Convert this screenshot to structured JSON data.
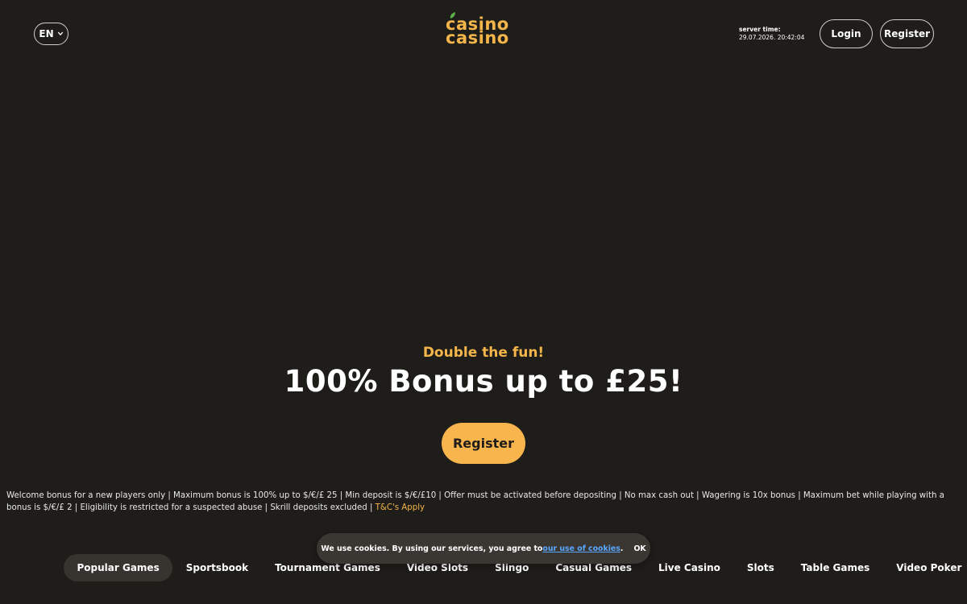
{
  "header": {
    "language": "EN",
    "logo": {
      "line1": "casino",
      "line2": "casino"
    },
    "server_time_label": "server time:",
    "server_time_value": "29.07.2026. 20:42:04",
    "login_label": "Login",
    "register_label": "Register"
  },
  "hero": {
    "kicker": "Double the fun!",
    "title": "100% Bonus up to £25!",
    "cta_label": "Register"
  },
  "terms": {
    "text": "Welcome bonus for a new players only | Maximum bonus is 100% up to $/€/£ 25 | Min deposit is $/€/£10 | Offer must be activated before depositing | No max cash out | Wagering is 10x bonus | Maximum bet while playing with a bonus is $/€/£ 2 | Eligibility is restricted for a suspected abuse | Skrill deposits excluded | ",
    "link_label": "T&C's Apply"
  },
  "cookie": {
    "text": "We use cookies. By using our services, you agree to ",
    "link_label": "our use of cookies",
    "suffix": ".",
    "ok_label": "OK"
  },
  "categories": [
    {
      "label": "Popular Games",
      "active": true
    },
    {
      "label": "Sportsbook"
    },
    {
      "label": "Tournament Games"
    },
    {
      "label": "Video Slots"
    },
    {
      "label": "Slingo"
    },
    {
      "label": "Casual Games"
    },
    {
      "label": "Live Casino"
    },
    {
      "label": "Slots"
    },
    {
      "label": "Table Games"
    },
    {
      "label": "Video Poker"
    }
  ],
  "icons": {
    "language": "chevron-down-icon",
    "search": "search-icon",
    "logo_leaf": "leaf-icon"
  },
  "colors": {
    "background": "#1f1d1a",
    "accent": "#f4b54a",
    "cta": "#f8b44d",
    "cookie_link": "#5aa7ff"
  }
}
